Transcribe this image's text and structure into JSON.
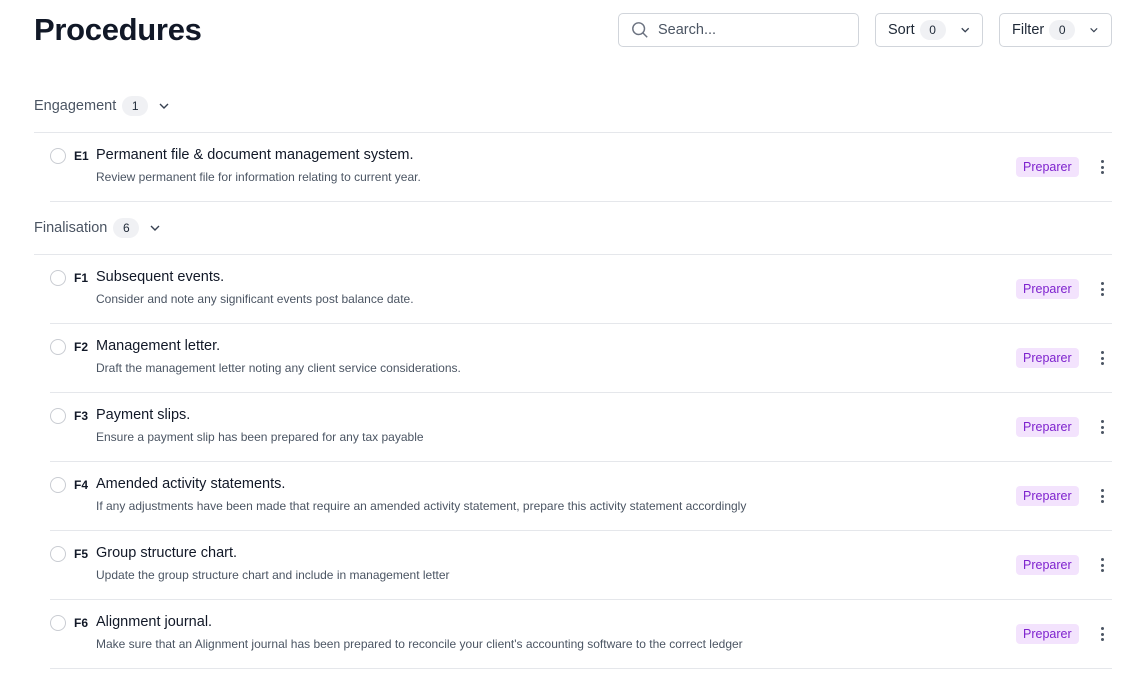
{
  "header": {
    "title": "Procedures",
    "search": {
      "placeholder": "Search...",
      "value": "",
      "icon": "search-icon"
    },
    "sort": {
      "label": "Sort",
      "count": "0",
      "icon": "chevron-down-icon"
    },
    "filter": {
      "label": "Filter",
      "count": "0",
      "icon": "chevron-down-icon"
    }
  },
  "colors": {
    "badge_bg": "#f3e3fd",
    "badge_text": "#7e22ce",
    "title_text": "#111827",
    "muted_text": "#4b5563",
    "divider": "#e5e7eb"
  },
  "groups": [
    {
      "name": "Engagement",
      "count": "1",
      "items": [
        {
          "code": "E1",
          "title": "Permanent file & document management system.",
          "description": "Review permanent file for information relating to current year.",
          "role": "Preparer"
        }
      ]
    },
    {
      "name": "Finalisation",
      "count": "6",
      "items": [
        {
          "code": "F1",
          "title": "Subsequent events.",
          "description": "Consider and note any significant events post balance date.",
          "role": "Preparer"
        },
        {
          "code": "F2",
          "title": "Management letter.",
          "description": "Draft the management letter noting any client service considerations.",
          "role": "Preparer"
        },
        {
          "code": "F3",
          "title": "Payment slips.",
          "description": "Ensure a payment slip has been prepared for any tax payable",
          "role": "Preparer"
        },
        {
          "code": "F4",
          "title": "Amended activity statements.",
          "description": "If any adjustments have been made that require an amended activity statement, prepare this activity statement accordingly",
          "role": "Preparer"
        },
        {
          "code": "F5",
          "title": "Group structure chart.",
          "description": "Update the group structure chart and include in management letter",
          "role": "Preparer"
        },
        {
          "code": "F6",
          "title": "Alignment journal.",
          "description": "Make sure that an Alignment journal has been prepared to reconcile your client's accounting software to the correct ledger",
          "role": "Preparer"
        }
      ]
    }
  ]
}
